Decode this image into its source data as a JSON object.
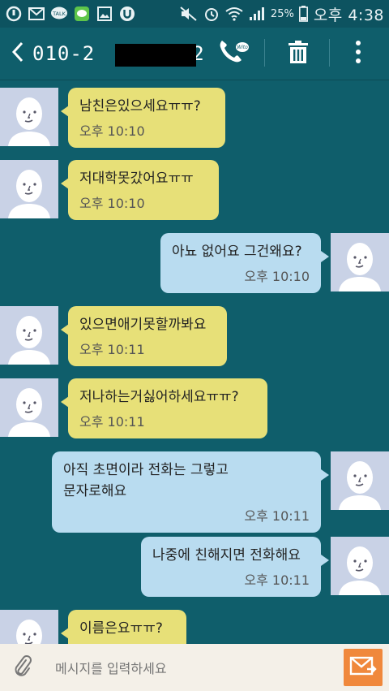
{
  "status": {
    "battery": "25%",
    "time": "오후 4:38"
  },
  "header": {
    "title_start": "010-2",
    "title_end": "2"
  },
  "messages": [
    {
      "dir": "in",
      "text": "남친은있으세요ㅠㅠ?",
      "time": "오후 10:10"
    },
    {
      "dir": "in",
      "text": "저대학못갔어요ㅠㅠ",
      "time": "오후 10:10"
    },
    {
      "dir": "out",
      "text": "아뇨 없어요 그건왜요?",
      "time": "오후 10:10"
    },
    {
      "dir": "in",
      "text": "있으면애기못할까봐요",
      "time": "오후 10:11"
    },
    {
      "dir": "in",
      "text": "저나하는거싫어하세요ㅠㅠ?",
      "time": "오후 10:11"
    },
    {
      "dir": "out",
      "text": "아직 초면이라 전화는 그렇고\n문자로해요",
      "time": "오후 10:11"
    },
    {
      "dir": "out",
      "text": "나중에 친해지면 전화해요",
      "time": "오후 10:11"
    },
    {
      "dir": "in",
      "text": "이름은요ㅠㅠ?",
      "time": ""
    }
  ],
  "input": {
    "placeholder": "메시지를 입력하세요"
  },
  "colors": {
    "background": "#0f5e6b",
    "incoming_bubble": "#e7e078",
    "outgoing_bubble": "#b9dcf0",
    "send_button": "#f0883c"
  }
}
